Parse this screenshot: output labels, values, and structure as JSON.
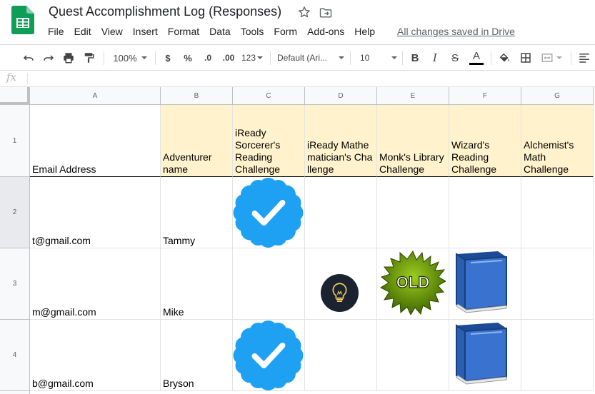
{
  "app": {
    "title": "Quest Accomplishment Log (Responses)",
    "menu": [
      "File",
      "Edit",
      "View",
      "Insert",
      "Format",
      "Data",
      "Tools",
      "Form",
      "Add-ons",
      "Help"
    ],
    "save_status": "All changes saved in Drive"
  },
  "toolbar": {
    "zoom": "100%",
    "currency": "$",
    "percent": "%",
    "decrease_decimal": ".0",
    "increase_decimal": ".00",
    "more_formats": "123",
    "font": "Default (Ari...",
    "font_size": "10",
    "bold": "B",
    "italic": "I",
    "strikethrough": "S",
    "text_color": "A",
    "text_color_value": "#000000"
  },
  "formula_bar": {
    "fx": "fx",
    "value": ""
  },
  "sheet": {
    "columns": [
      "A",
      "B",
      "C",
      "D",
      "E",
      "F",
      "G"
    ],
    "rows": [
      "1",
      "2",
      "3",
      "4"
    ],
    "header_fill": "#fff2cc",
    "headers": [
      "Email Address",
      "Adventurer name",
      "iReady Sorcerer's Reading Challenge",
      "iReady Mathematician's Challenge",
      "Monk's Library Challenge",
      "Wizard's Reading Challenge",
      "Alchemist's Math Challenge"
    ],
    "data": [
      {
        "email": "t@gmail.com",
        "name": "Tammy",
        "badges": {
          "C": "verified-badge-icon"
        }
      },
      {
        "email": "m@gmail.com",
        "name": "Mike",
        "badges": {
          "D": "lightbulb-icon",
          "E": "old-starburst-icon",
          "F": "blue-book-icon"
        },
        "old_label": "OLD"
      },
      {
        "email": "b@gmail.com",
        "name": "Bryson",
        "badges": {
          "C": "verified-badge-icon",
          "F": "blue-book-icon"
        }
      }
    ]
  },
  "colors": {
    "sheets_green": "#0f9d58",
    "verified_blue": "#1ea1f2",
    "book_blue": "#2a5fb0",
    "old_green": "#5a8a00"
  }
}
